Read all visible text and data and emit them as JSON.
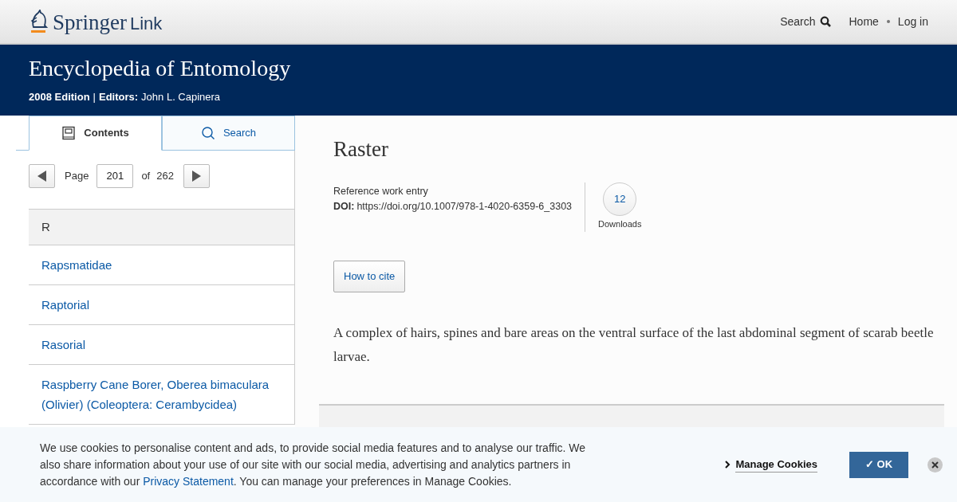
{
  "header": {
    "logo": {
      "brand": "Springer",
      "product": "Link"
    },
    "nav": [
      {
        "label": "Search",
        "kind": "search"
      },
      {
        "label": "Home",
        "kind": "link"
      },
      {
        "label": "Log in",
        "kind": "link"
      }
    ]
  },
  "banner": {
    "title": "Encyclopedia of Entomology",
    "edition": "2008 Edition",
    "separator": "|",
    "editors_label": "Editors:",
    "editors": "John L. Capinera"
  },
  "sidebar": {
    "tabs": [
      {
        "label": "Contents",
        "kind": "contents",
        "selected": true
      },
      {
        "label": "Search",
        "kind": "search",
        "selected": false
      }
    ],
    "pager": {
      "label": "Page",
      "value": "201",
      "of": "of",
      "total": "262"
    },
    "letter": "R",
    "entries": [
      "Rapsmatidae",
      "Raptorial",
      "Rasorial",
      "Raspberry Cane Borer, Oberea bimaculara (Olivier) (Coleoptera: Cerambycidea)"
    ]
  },
  "article": {
    "title": "Raster",
    "type": "Reference work entry",
    "doi_label": "DOI:",
    "doi": "https://doi.org/10.1007/978-1-4020-6359-6_3303",
    "downloads": {
      "count": "12",
      "label": "Downloads"
    },
    "cite_button": "How to cite",
    "body": "A complex of hairs, spines and bare areas on the ventral surface of the last abdominal segment of scarab beetle larvae."
  },
  "cookie_banner": {
    "text_before": "We use cookies to personalise content and ads, to provide social media features and to analyse our traffic. We also share information about your use of our site with our social media, advertising and analytics partners in accordance with our ",
    "link": "Privacy Statement",
    "text_after": ". You can manage your preferences in Manage Cookies.",
    "manage": "Manage Cookies",
    "ok": "✓ OK"
  }
}
